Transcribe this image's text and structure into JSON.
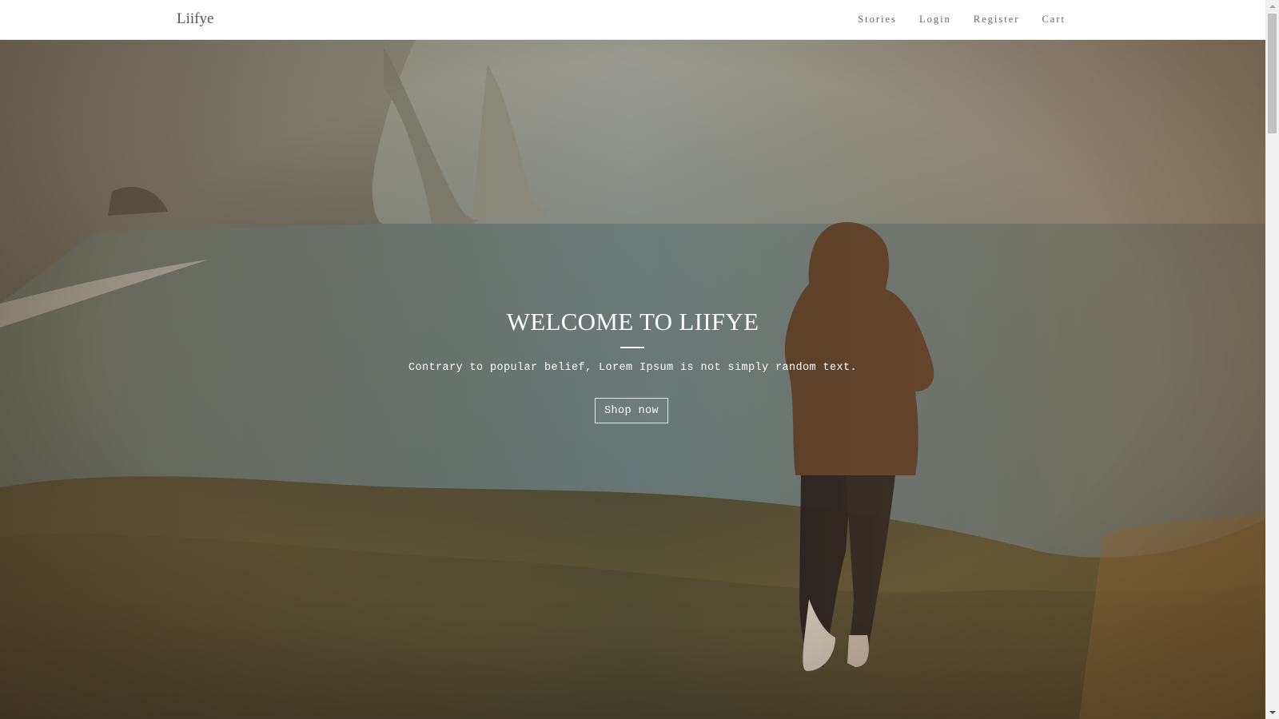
{
  "navbar": {
    "brand": "Liifye",
    "links": [
      "Stories",
      "Login",
      "Register",
      "Cart"
    ]
  },
  "hero": {
    "title": "WELCOME TO LIIFYE",
    "subtitle": "Contrary to popular belief, Lorem Ipsum is not simply random text.",
    "button_label": "Shop now"
  },
  "colors": {
    "navbar_bg": "#ffffff",
    "nav_text": "#666666",
    "hero_text": "#ffffff"
  }
}
